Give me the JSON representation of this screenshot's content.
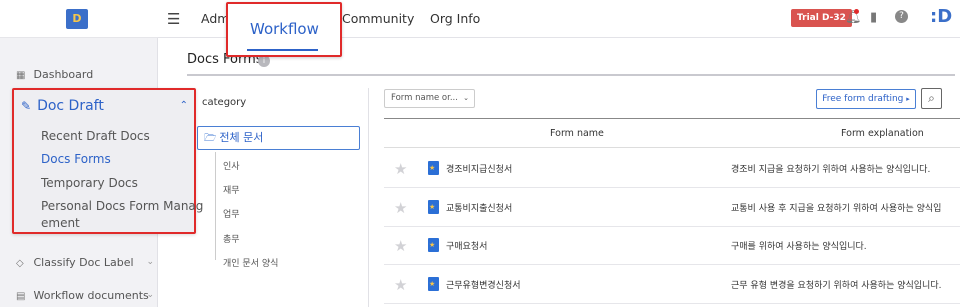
{
  "sidebar": {
    "items": [
      {
        "label": "Dashboard",
        "icon": "dashboard-icon"
      },
      {
        "label": "Classify Doc Label",
        "icon": "tag-icon"
      },
      {
        "label": "Workflow documents",
        "icon": "document-icon"
      }
    ],
    "doc_draft": {
      "title": "Doc Draft",
      "submenu": [
        "Recent Draft Docs",
        "Docs Forms",
        "Temporary Docs",
        "Personal Docs Form Manag",
        "ement"
      ]
    }
  },
  "topbar": {
    "tabs": [
      "Adm",
      "Workflow",
      "Community",
      "Org Info"
    ],
    "trial": "Trial D-32",
    "logo_letter": "D",
    "app_logo_letter": ":D"
  },
  "main": {
    "page_title": "Docs Forms",
    "category_header": "category",
    "category_all": "전체 문서",
    "categories": [
      "인사",
      "재무",
      "업무",
      "총무",
      "개인 문서 양식"
    ],
    "filter_select": "Form name or...",
    "free_button": "Free form drafting",
    "columns": [
      "Form name",
      "Form explanation"
    ],
    "rows": [
      {
        "name": "경조비지급신청서",
        "desc": "경조비 지급을 요청하기 위하여 사용하는 양식입니다."
      },
      {
        "name": "교통비지출신청서",
        "desc": "교통비 사용 후 지급을 요청하기 위하여 사용하는 양식입"
      },
      {
        "name": "구매요청서",
        "desc": "구매를 위하여 사용하는 양식입니다."
      },
      {
        "name": "근무유형변경신청서",
        "desc": "근무 유형 변경을 요청하기 위하여 사용하는 양식입니다."
      }
    ]
  },
  "colors": {
    "accent": "#2d62c8",
    "highlight": "#e02a2a",
    "trial": "#d9534f"
  }
}
